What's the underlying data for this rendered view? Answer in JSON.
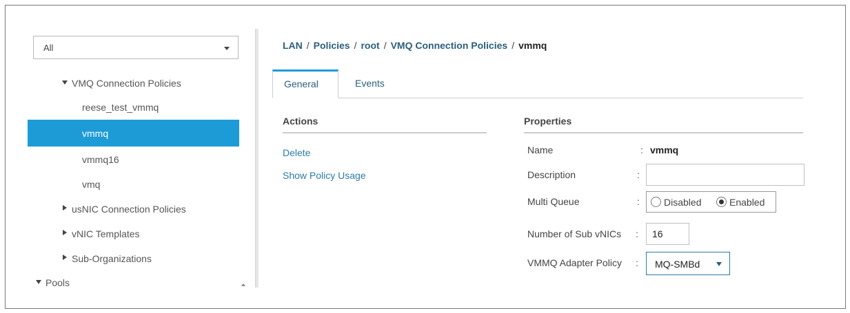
{
  "filter": {
    "value": "All"
  },
  "tree": {
    "vmq_policies": "VMQ Connection Policies",
    "items": [
      "reese_test_vmmq",
      "vmmq",
      "vmmq16",
      "vmq"
    ],
    "usnic": "usNIC Connection Policies",
    "vnic_templates": "vNIC Templates",
    "sub_orgs": "Sub-Organizations",
    "pools": "Pools"
  },
  "breadcrumb": {
    "items": [
      "LAN",
      "Policies",
      "root",
      "VMQ Connection Policies"
    ],
    "current": "vmmq",
    "separator": "/"
  },
  "tabs": {
    "general": "General",
    "events": "Events"
  },
  "actions": {
    "heading": "Actions",
    "delete": "Delete",
    "show_usage": "Show Policy Usage"
  },
  "properties": {
    "heading": "Properties",
    "colon": ":",
    "name_label": "Name",
    "name_value": "vmmq",
    "description_label": "Description",
    "description_value": "",
    "multi_queue_label": "Multi Queue",
    "multi_queue_options": [
      "Disabled",
      "Enabled"
    ],
    "multi_queue_selected": "Enabled",
    "sub_vnics_label": "Number of Sub vNICs",
    "sub_vnics_value": "16",
    "adapter_policy_label": "VMMQ Adapter Policy",
    "adapter_policy_value": "MQ-SMBd"
  },
  "colors": {
    "accent": "#1d9bd7",
    "link": "#2b7ba6",
    "breadcrumb": "#2b5f7a"
  }
}
